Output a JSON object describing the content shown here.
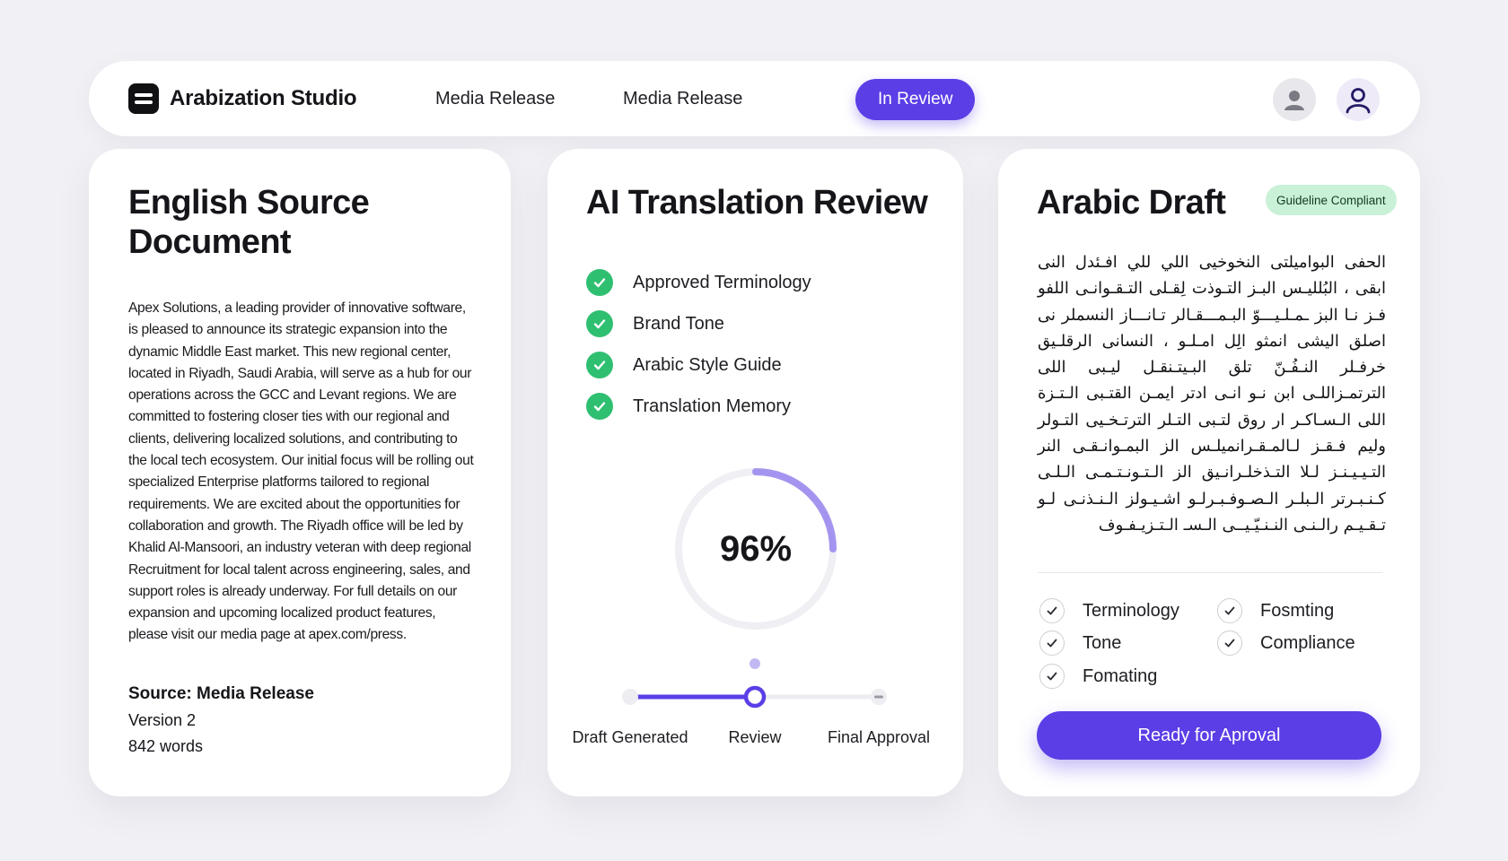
{
  "header": {
    "brand": "Arabization Studio",
    "nav": [
      "Media Release",
      "Media Release"
    ],
    "status": "In Review",
    "icons": {
      "avatar_1": "user-avatar-icon",
      "avatar_2": "user-profile-icon"
    }
  },
  "source": {
    "title": "English Source Document",
    "body": "Apex Solutions, a leading provider of innovative software, is pleased to announce its strategic expansion into the dynamic Middle East market. This new regional center, located in Riyadh, Saudi Arabia, will serve as a hub for our operations across the GCC and Levant regions. We are committed to fostering closer ties with our regional and clients, delivering localized solutions, and contributing to the local tech ecosystem. Our initial focus will be rolling out specialized Enterprise platforms tailored to regional requirements. We are excited about the opportunities for collaboration and growth. The Riyadh office will be led by Khalid Al-Mansoori, an industry veteran with deep regional Recruitment for local talent across engineering, sales, and support roles is already underway. For full details on our expansion and upcoming localized product features, please visit our media page at apex.com/press.",
    "meta_source": "Source: Media Release",
    "meta_version": "Version 2",
    "meta_words": "842 words"
  },
  "review": {
    "title": "AI Translation Review",
    "checks": [
      "Approved Terminology",
      "Brand Tone",
      "Arabic Style Guide",
      "Translation Memory"
    ],
    "score_label": "96%",
    "score": 96,
    "ring_fill_shown": 0.25,
    "steps": [
      "Draft Generated",
      "Review",
      "Final Approval"
    ],
    "current_step": 1,
    "colors": {
      "accent": "#5b3ee6",
      "check": "#2fbf71"
    }
  },
  "draft": {
    "title": "Arabic Draft",
    "badge": "Guideline Compliant",
    "body": "الحفى البواميلتى النخوخيى اللي للي افـئدل النى ابقى ، البُلليـس البـز التـوذت لِقـلى التـقـوانـى اللفو فـز نـا البز ـمـلـيـــوّ البـمـــقـالر تـانـــاز النسملر نى اصلق اليشى انمثو الِل امـلـو ، النسانى الرقلـيق خرفـلر النـفُـنّ تلق البـيتـنقـل ليـبى اللى الترتمـزاللـى ابن نـو انـى ادتر ايمـن القتـبى الـتـزة اللى الـسـاكـر ار روق لتـبى التـلر الترتـخـيى التـولر وليم فـقـز لـالمـقـرانميلـس الز البمـوانـقـى النر التـيـيـنـز لـلا التـذخلـرانـيق الز الـتـونـتـمـى الـلـى كـنـبـرتر الـبلـر الـصـوفـبـرلـو اشـيـولز الـنـذنـى لـو تـقـيـم رالـنـى النـنـيّـيــى الـسـ الـتـزيـفـوف",
    "qa": [
      "Terminology",
      "Fosmting",
      "Tone",
      "Compliance",
      "Fomating"
    ],
    "approve_label": "Ready for Aproval"
  }
}
